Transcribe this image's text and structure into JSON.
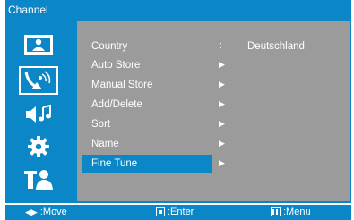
{
  "header": {
    "title": "Channel"
  },
  "sidebar": {
    "items": [
      {
        "icon": "picture-icon",
        "selected": false
      },
      {
        "icon": "antenna-channel-icon",
        "selected": true
      },
      {
        "icon": "sound-icon",
        "selected": false
      },
      {
        "icon": "settings-gear-icon",
        "selected": false
      },
      {
        "icon": "person-lock-icon",
        "selected": false
      }
    ]
  },
  "menu": {
    "items": [
      {
        "label": "Country",
        "separator": ":",
        "value": "Deutschland"
      },
      {
        "label": "Auto Store",
        "arrow": "▶"
      },
      {
        "label": "Manual Store",
        "arrow": "▶"
      },
      {
        "label": "Add/Delete",
        "arrow": "▶"
      },
      {
        "label": "Sort",
        "arrow": "▶"
      },
      {
        "label": "Name",
        "arrow": "▶"
      },
      {
        "label": "Fine Tune",
        "arrow": "▶",
        "selected": true
      }
    ]
  },
  "footer": {
    "move": {
      "icon": "◀▶",
      "label": ":Move"
    },
    "enter": {
      "label": ":Enter"
    },
    "menu": {
      "label": ":Menu"
    }
  },
  "colors": {
    "accent": "#0b87c7",
    "panel": "#9b9b9b",
    "text": "#ffffff"
  }
}
